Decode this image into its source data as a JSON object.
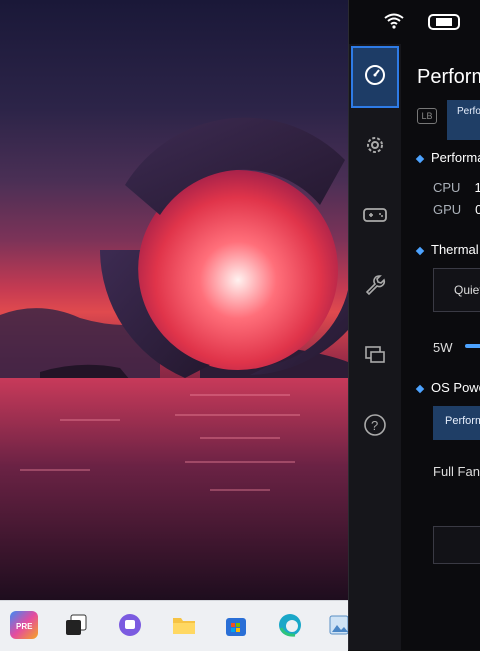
{
  "panel": {
    "title": "Performance",
    "lb_label": "LB",
    "tab_label": "Performance",
    "sections": {
      "performance": "Performance",
      "thermal": "Thermal",
      "os_power": "OS Power"
    },
    "cpu_label": "CPU",
    "cpu_value": "1",
    "gpu_label": "GPU",
    "gpu_value": "0",
    "thermal_option": "Quiet",
    "slider_min_label": "5W",
    "os_power_option": "Performance",
    "full_fan_label": "Full Fan"
  },
  "taskbar": {
    "apps": [
      "copilot-pre-icon",
      "task-view-icon",
      "teams-icon",
      "file-explorer-icon",
      "store-icon",
      "edge-icon",
      "photos-icon"
    ]
  },
  "sidebar": {
    "items": [
      "performance-gauge-icon",
      "settings-gear-icon",
      "controller-icon",
      "wrench-icon",
      "display-icon",
      "help-icon"
    ]
  },
  "colors": {
    "accent": "#2e7be6",
    "panel_bg": "#0b0b0e",
    "sidebar_bg": "#16161b",
    "selected_bg": "#1f3e66"
  }
}
